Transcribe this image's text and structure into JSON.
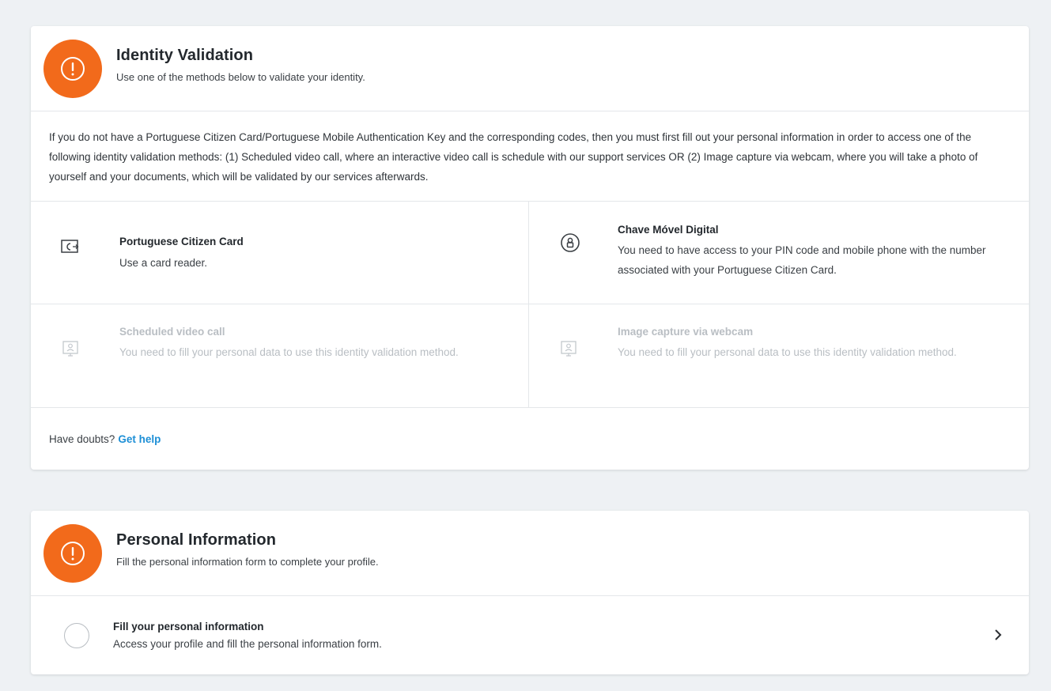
{
  "identity": {
    "title": "Identity Validation",
    "subtitle": "Use one of the methods below to validate your identity.",
    "intro": "If you do not have a Portuguese Citizen Card/Portuguese Mobile Authentication Key and the corresponding codes, then you must first fill out your personal information in order to access one of the following identity validation methods: (1) Scheduled video call, where an interactive video call is schedule with our support services OR (2) Image capture via webcam, where you will take a photo of yourself and your documents, which will be validated by our services afterwards.",
    "methods": [
      {
        "title": "Portuguese Citizen Card",
        "desc": "Use a card reader.",
        "icon": "card-reader-icon",
        "enabled": true
      },
      {
        "title": "Chave Móvel Digital",
        "desc": "You need to have access to your PIN code and mobile phone with the number associated with your Portuguese Citizen Card.",
        "icon": "mobile-key-icon",
        "enabled": true
      },
      {
        "title": "Scheduled video call",
        "desc": "You need to fill your personal data to use this identity validation method.",
        "icon": "video-call-icon",
        "enabled": false
      },
      {
        "title": "Image capture via webcam",
        "desc": "You need to fill your personal data to use this identity validation method.",
        "icon": "webcam-icon",
        "enabled": false
      }
    ],
    "help_prefix": "Have doubts?",
    "help_link": "Get help"
  },
  "personal": {
    "title": "Personal Information",
    "subtitle": "Fill the personal information form to complete your profile.",
    "item_title": "Fill your personal information",
    "item_desc": "Access your profile and fill the personal information form."
  },
  "colors": {
    "background": "#eef1f4",
    "warning_badge": "#f26a1b",
    "link": "#1d8fd6",
    "disabled_text": "#b9bec3"
  }
}
